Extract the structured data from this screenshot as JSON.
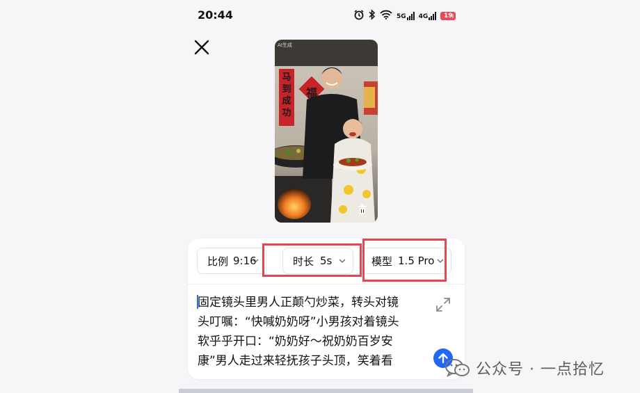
{
  "status_bar": {
    "time": "20:44",
    "signal_1_label": "5G",
    "signal_2_label": "4G",
    "battery_level": "19",
    "icons": [
      "alarm-icon",
      "bluetooth-icon",
      "wifi-icon",
      "cellular-5g-icon",
      "cellular-4g-icon",
      "battery-icon"
    ]
  },
  "video_preview": {
    "watermark": "AI生成",
    "couplet_text": "马到成功",
    "fu_character": "福"
  },
  "settings": {
    "ratio_label": "比例",
    "ratio_value": "9:16",
    "duration_label": "时长",
    "duration_value": "5s",
    "model_label": "模型",
    "model_value": "1.5 Pro"
  },
  "prompt": {
    "lines": [
      "固定镜头里男人正颠勺炒菜，转头对镜",
      "头叮嘱：“快喊奶奶呀”小男孩对着镜头",
      "软乎乎开口：“奶奶好～祝奶奶百岁安",
      "康”男人走过来轻抚孩子头顶，笑着看"
    ]
  },
  "watermark_overlay": {
    "text": "公众号 · 一点拾忆"
  },
  "colors": {
    "accent_blue": "#1f67f5",
    "highlight_red": "#e6444f",
    "battery_red": "#e84a57"
  }
}
